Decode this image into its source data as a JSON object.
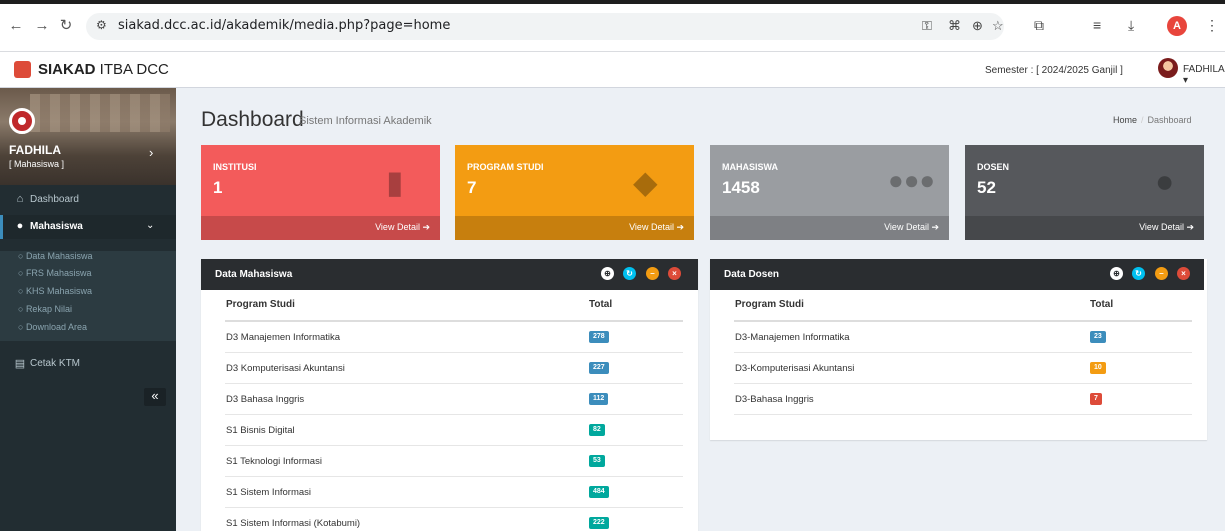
{
  "browser": {
    "url": "siakad.dcc.ac.id/akademik/media.php?page=home",
    "profile_initial": "A"
  },
  "header": {
    "brand_bold": "SIAKAD",
    "brand_rest": " ITBA DCC",
    "semester": "Semester : [ 2024/2025 Ganjil ]",
    "user": "FADHILA ▾"
  },
  "sidebar": {
    "user_name": "FADHILA",
    "user_role": "[ Mahasiswa ]",
    "items": [
      {
        "label": "Dashboard",
        "icon": "home-icon"
      },
      {
        "label": "Mahasiswa",
        "icon": "user-icon"
      },
      {
        "label": "Cetak KTM",
        "icon": "id-card-icon"
      }
    ],
    "submenu": [
      "Data Mahasiswa",
      "FRS Mahasiswa",
      "KHS Mahasiswa",
      "Rekap Nilai",
      "Download Area"
    ]
  },
  "page": {
    "title": "Dashboard",
    "subtitle": "Sistem Informasi Akademik",
    "breadcrumb_home": "Home",
    "breadcrumb_current": "Dashboard"
  },
  "stats": [
    {
      "label": "INSTITUSI",
      "value": "1",
      "footer": "View Detail ➔",
      "color": "#f35b5b"
    },
    {
      "label": "PROGRAM STUDI",
      "value": "7",
      "footer": "View Detail ➔",
      "color": "#f39c12"
    },
    {
      "label": "MAHASISWA",
      "value": "1458",
      "footer": "View Detail ➔",
      "color": "#9a9da1"
    },
    {
      "label": "DOSEN",
      "value": "52",
      "footer": "View Detail ➔",
      "color": "#56585c"
    }
  ],
  "data_mahasiswa": {
    "title": "Data Mahasiswa",
    "col_program": "Program Studi",
    "col_total": "Total",
    "rows": [
      {
        "program": "D3 Manajemen Informatika",
        "total": "278",
        "color": "#3c8dbc"
      },
      {
        "program": "D3 Komputerisasi Akuntansi",
        "total": "227",
        "color": "#3c8dbc"
      },
      {
        "program": "D3 Bahasa Inggris",
        "total": "112",
        "color": "#3c8dbc"
      },
      {
        "program": "S1 Bisnis Digital",
        "total": "82",
        "color": "#00a89d"
      },
      {
        "program": "S1 Teknologi Informasi",
        "total": "53",
        "color": "#00a89d"
      },
      {
        "program": "S1 Sistem Informasi",
        "total": "484",
        "color": "#00a89d"
      },
      {
        "program": "S1 Sistem Informasi (Kotabumi)",
        "total": "222",
        "color": "#00a89d"
      }
    ]
  },
  "data_dosen": {
    "title": "Data Dosen",
    "col_program": "Program Studi",
    "col_total": "Total",
    "rows": [
      {
        "program": "D3-Manajemen Informatika",
        "total": "23",
        "color": "#3c8dbc"
      },
      {
        "program": "D3-Komputerisasi Akuntansi",
        "total": "10",
        "color": "#f39c12"
      },
      {
        "program": "D3-Bahasa Inggris",
        "total": "7",
        "color": "#dd4b39"
      }
    ]
  }
}
